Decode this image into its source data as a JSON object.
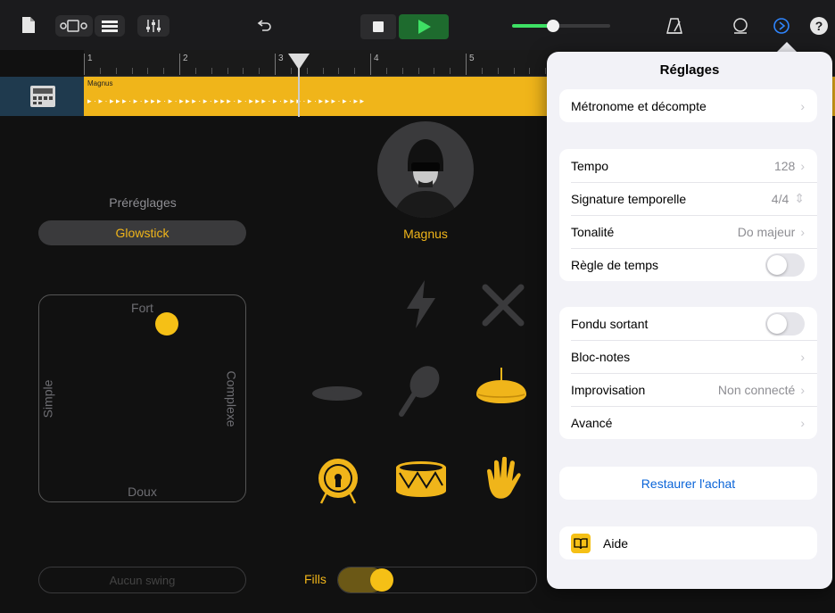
{
  "ruler": {
    "marks": [
      "1",
      "2",
      "3",
      "4",
      "5"
    ]
  },
  "region": {
    "label": "Magnus"
  },
  "presets": {
    "title": "Préréglages",
    "selected": "Glowstick"
  },
  "drummer": {
    "name": "Magnus"
  },
  "pad": {
    "top": "Fort",
    "bottom": "Doux",
    "left": "Simple",
    "right": "Complexe"
  },
  "swing": {
    "label": "Aucun swing"
  },
  "fills": {
    "label": "Fills"
  },
  "settings": {
    "title": "Réglages",
    "metronome": "Métronome et décompte",
    "tempo_label": "Tempo",
    "tempo_value": "128",
    "signature_label": "Signature temporelle",
    "signature_value": "4/4",
    "key_label": "Tonalité",
    "key_value": "Do majeur",
    "ruler_label": "Règle de temps",
    "fade_label": "Fondu sortant",
    "notes_label": "Bloc-notes",
    "jam_label": "Improvisation",
    "jam_value": "Non connecté",
    "advanced_label": "Avancé",
    "restore_label": "Restaurer l'achat",
    "help_label": "Aide"
  },
  "colors": {
    "accent": "#f0b51a",
    "link": "#0a64d8",
    "play": "#1e6b2e"
  },
  "icons": [
    "document-icon",
    "tracks-view-icon",
    "mixer-icon",
    "undo-icon",
    "stop-icon",
    "play-icon",
    "volume-slider-icon",
    "metronome-icon",
    "loop-icon",
    "settings-icon",
    "help-icon"
  ]
}
